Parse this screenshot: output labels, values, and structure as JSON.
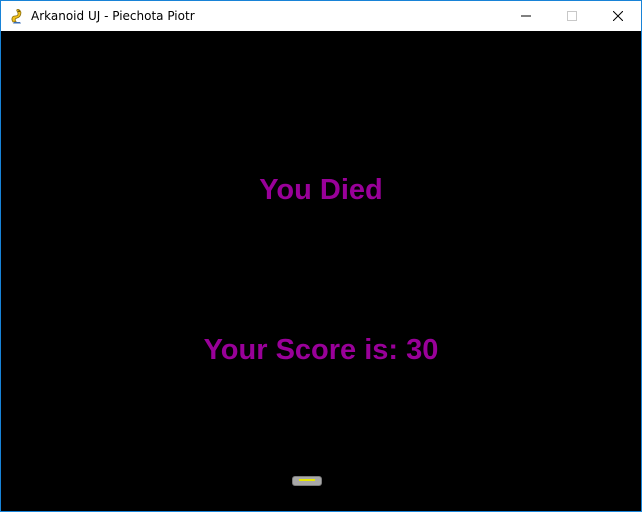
{
  "window": {
    "title": "Arkanoid UJ - Piechota Piotr",
    "app_icon": "pygame-snake-icon",
    "controls": {
      "minimize_icon": "minimize-icon",
      "maximize_icon": "maximize-icon",
      "close_icon": "close-icon"
    }
  },
  "game_over": {
    "headline": "You Died",
    "score_text": "Your Score is: 30"
  },
  "colors": {
    "game_background": "#000000",
    "message_text": "#990099",
    "paddle_body": "#a8a8a8",
    "paddle_stripe": "#e8e800",
    "window_border": "#1883d7"
  }
}
